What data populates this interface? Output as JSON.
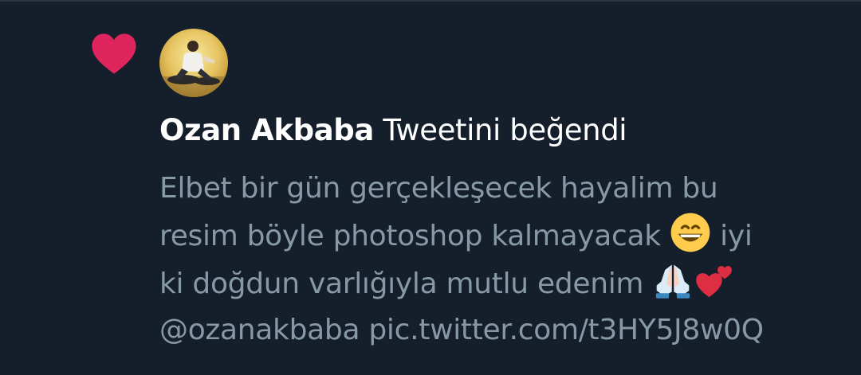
{
  "notification": {
    "icon": "heart-icon",
    "heart_color": "#e0245e",
    "user_name": "Ozan Akbaba",
    "action_text": "Tweetini beğendi",
    "tweet": {
      "line1": "Elbet bir gün gerçekleşecek hayalim bu",
      "line2_text": "resim böyle photoshop kalmayacak",
      "line2_after": "iyi",
      "line3_text": "ki doğdun varlığıyla mutlu edenim",
      "line4": "@ozanakbaba pic.twitter.com/t3HY5J8w0Q",
      "emoji_1": "grinning-face-emoji",
      "emoji_2": "folded-hands-emoji",
      "emoji_3": "two-hearts-emoji"
    }
  },
  "colors": {
    "background": "#151f2b",
    "primary_text": "#ffffff",
    "secondary_text": "#8899a6"
  }
}
